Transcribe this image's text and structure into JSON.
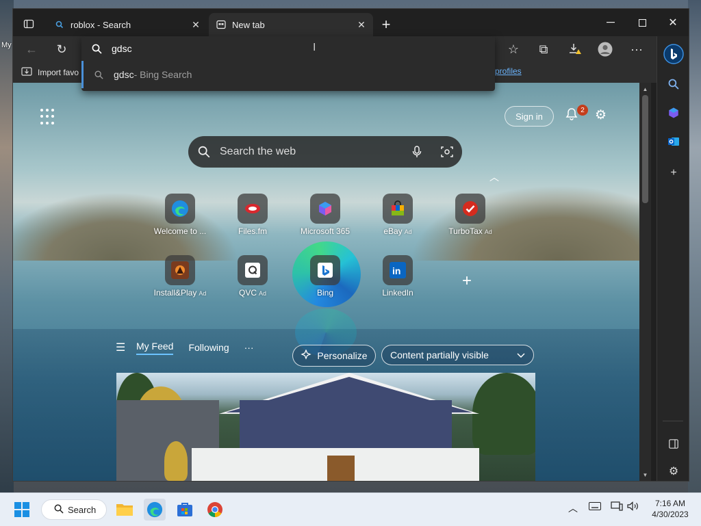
{
  "desktop": {
    "left_label": "My"
  },
  "tabs": [
    {
      "title": "roblox - Search",
      "icon": "bing-search-icon",
      "active": false
    },
    {
      "title": "New tab",
      "icon": "new-tab-page-icon",
      "active": true
    }
  ],
  "address_bar": {
    "value": "gdsc",
    "suggestion_query": "gdsc",
    "suggestion_suffix": " - Bing Search"
  },
  "favorites_bar": {
    "import_label": "Import favo",
    "profiles_link": "profiles"
  },
  "ntp": {
    "sign_in": "Sign in",
    "notification_count": "2",
    "search_placeholder": "Search the web",
    "tiles": [
      {
        "label": "Welcome to ...",
        "ad": ""
      },
      {
        "label": "Files.fm",
        "ad": ""
      },
      {
        "label": "Microsoft 365",
        "ad": ""
      },
      {
        "label": "eBay",
        "ad": "Ad"
      },
      {
        "label": "TurboTax",
        "ad": "Ad"
      },
      {
        "label": "Install&Play",
        "ad": "Ad"
      },
      {
        "label": "QVC",
        "ad": "Ad"
      },
      {
        "label": "Bing",
        "ad": ""
      },
      {
        "label": "LinkedIn",
        "ad": ""
      }
    ],
    "feed_tabs": [
      "My Feed",
      "Following"
    ],
    "more": "···",
    "personalize": "Personalize",
    "content_visibility": "Content partially visible"
  },
  "taskbar": {
    "search_label": "Search",
    "time": "7:16 AM",
    "date": "4/30/2023"
  },
  "colors": {
    "accent": "#4a90d9",
    "badge": "#c43e1c",
    "link": "#6cb6ff"
  }
}
